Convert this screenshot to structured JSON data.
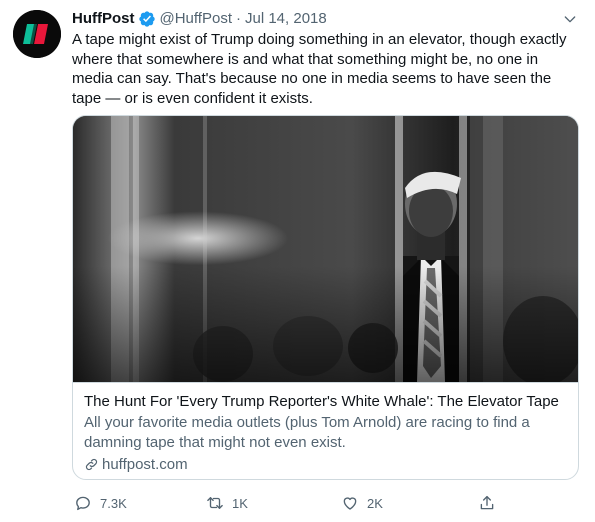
{
  "tweet": {
    "author_name": "HuffPost",
    "handle": "@HuffPost",
    "separator": "·",
    "date": "Jul 14, 2018",
    "text": "A tape might exist of Trump doing something in an elevator, though exactly where that somewhere is and what that something might be, no one in media can say. That's because no one in media seems to have seen the tape — or is even confident it exists."
  },
  "card": {
    "title": "The Hunt For 'Every Trump Reporter's White Whale': The Elevator Tape",
    "description": "All your favorite media outlets (plus Tom Arnold) are racing to find a damning tape that might not even exist.",
    "domain": "huffpost.com"
  },
  "actions": {
    "replies": "7.3K",
    "retweets": "1K",
    "likes": "2K"
  },
  "colors": {
    "text": "#0f1419",
    "secondary": "#536471",
    "verified": "#1d9bf0",
    "border": "#cfd9de",
    "brand_green": "#0dbe98",
    "brand_red": "#e8173a"
  },
  "icons": [
    "huffpost-logo",
    "verified-icon",
    "chevron-down-icon",
    "link-icon",
    "reply-icon",
    "retweet-icon",
    "like-icon",
    "share-icon"
  ]
}
